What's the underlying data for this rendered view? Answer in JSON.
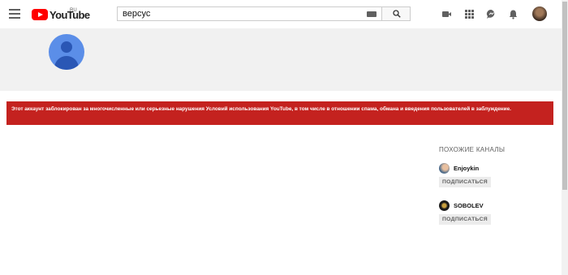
{
  "header": {
    "logo_text": "YouTube",
    "logo_region": "RU",
    "search_value": "версус",
    "icons": {
      "menu": "menu-icon",
      "keyboard": "keyboard-icon",
      "search": "search-icon",
      "create": "video-camera-icon",
      "apps": "apps-grid-icon",
      "messages": "chat-icon",
      "notifications": "bell-icon",
      "account": "avatar"
    }
  },
  "channel": {
    "avatar_icon": "default-user-avatar",
    "ban_message": "Этот аккаунт заблокирован за многочисленные или серьезные нарушения Условий использования YouTube, в том числе в отношении спама, обмана и введения пользователей в заблуждение."
  },
  "related": {
    "title": "ПОХОЖИЕ КАНАЛЫ",
    "channels": [
      {
        "name": "Enjoykin",
        "subscribe_label": "ПОДПИСАТЬСЯ"
      },
      {
        "name": "SOBOLEV",
        "subscribe_label": "ПОДПИСАТЬСЯ"
      }
    ]
  },
  "colors": {
    "brand_red": "#ff0000",
    "ban_banner": "#c4221f",
    "avatar_blue": "#5b8ee8"
  }
}
